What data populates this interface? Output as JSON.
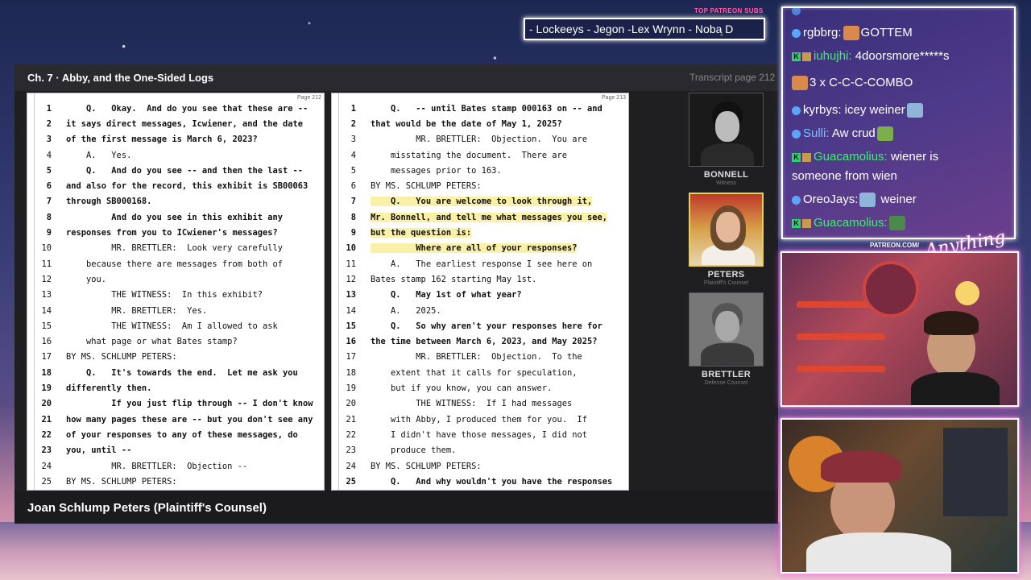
{
  "overlay": {
    "subs_label": "TOP PATREON SUBS",
    "subs_text": "- Lockeeys - Jegon -Lex Wrynn -  Noba D",
    "patreon_label": "PATREON.COM/",
    "logo_script": "Anything Else?"
  },
  "panel": {
    "chapter": "Ch. 7  ·  Abby, and the One-Sided Logs",
    "page_indicator": "Transcript page 212",
    "speaker": "Joan Schlump Peters (Plaintiff's Counsel)"
  },
  "transcript_left": {
    "page_no": "Page 212",
    "lines": [
      {
        "n": "1",
        "t": "    Q.   Okay.  And do you see that these are --",
        "b": true
      },
      {
        "n": "2",
        "t": "it says direct messages, Icwiener, and the date",
        "b": true
      },
      {
        "n": "3",
        "t": "of the first message is March 6, 2023?",
        "b": true
      },
      {
        "n": "4",
        "t": "    A.   Yes.",
        "b": false
      },
      {
        "n": "5",
        "t": "    Q.   And do you see -- and then the last --",
        "b": true
      },
      {
        "n": "6",
        "t": "and also for the record, this exhibit is SB00063",
        "b": true
      },
      {
        "n": "7",
        "t": "through SB000168.",
        "b": true
      },
      {
        "n": "8",
        "t": "         And do you see in this exhibit any",
        "b": true
      },
      {
        "n": "9",
        "t": "responses from you to ICwiener's messages?",
        "b": true
      },
      {
        "n": "10",
        "t": "         MR. BRETTLER:  Look very carefully",
        "b": false
      },
      {
        "n": "11",
        "t": "    because there are messages from both of",
        "b": false
      },
      {
        "n": "12",
        "t": "    you.",
        "b": false
      },
      {
        "n": "13",
        "t": "         THE WITNESS:  In this exhibit?",
        "b": false
      },
      {
        "n": "14",
        "t": "         MR. BRETTLER:  Yes.",
        "b": false
      },
      {
        "n": "15",
        "t": "         THE WITNESS:  Am I allowed to ask",
        "b": false
      },
      {
        "n": "16",
        "t": "    what page or what Bates stamp?",
        "b": false
      },
      {
        "n": "17",
        "t": "BY MS. SCHLUMP PETERS:",
        "b": false
      },
      {
        "n": "18",
        "t": "    Q.   It's towards the end.  Let me ask you",
        "b": true
      },
      {
        "n": "19",
        "t": "differently then.",
        "b": true
      },
      {
        "n": "20",
        "t": "         If you just flip through -- I don't know",
        "b": true
      },
      {
        "n": "21",
        "t": "how many pages these are -- but you don't see any",
        "b": true
      },
      {
        "n": "22",
        "t": "of your responses to any of these messages, do",
        "b": true
      },
      {
        "n": "23",
        "t": "you, until --",
        "b": true
      },
      {
        "n": "24",
        "t": "         MR. BRETTLER:  Objection --",
        "b": false
      },
      {
        "n": "25",
        "t": "BY MS. SCHLUMP PETERS:",
        "b": false
      }
    ]
  },
  "transcript_right": {
    "page_no": "Page 213",
    "lines": [
      {
        "n": "1",
        "t": "    Q.   -- until Bates stamp 000163 on -- and",
        "b": true
      },
      {
        "n": "2",
        "t": "that would be the date of May 1, 2025?",
        "b": true
      },
      {
        "n": "3",
        "t": "         MR. BRETTLER:  Objection.  You are",
        "b": false
      },
      {
        "n": "4",
        "t": "    misstating the document.  There are",
        "b": false
      },
      {
        "n": "5",
        "t": "    messages prior to 163.",
        "b": false
      },
      {
        "n": "6",
        "t": "BY MS. SCHLUMP PETERS:",
        "b": false
      },
      {
        "n": "7",
        "t": "    Q.   You are welcome to look through it,",
        "b": true,
        "h": true
      },
      {
        "n": "8",
        "t": "Mr. Bonnell, and tell me what messages you see,",
        "b": true,
        "h": true
      },
      {
        "n": "9",
        "t": "but the question is:",
        "b": true,
        "h": true
      },
      {
        "n": "10",
        "t": "         Where are all of your responses?",
        "b": true,
        "h": true
      },
      {
        "n": "11",
        "t": "    A.   The earliest response I see here on",
        "b": false
      },
      {
        "n": "12",
        "t": "Bates stamp 162 starting May 1st.",
        "b": false
      },
      {
        "n": "13",
        "t": "    Q.   May 1st of what year?",
        "b": true
      },
      {
        "n": "14",
        "t": "    A.   2025.",
        "b": false
      },
      {
        "n": "15",
        "t": "    Q.   So why aren't your responses here for",
        "b": true
      },
      {
        "n": "16",
        "t": "the time between March 6, 2023, and May 2025?",
        "b": true
      },
      {
        "n": "17",
        "t": "         MR. BRETTLER:  Objection.  To the",
        "b": false
      },
      {
        "n": "18",
        "t": "    extent that it calls for speculation,",
        "b": false
      },
      {
        "n": "19",
        "t": "    but if you know, you can answer.",
        "b": false
      },
      {
        "n": "20",
        "t": "         THE WITNESS:  If I had messages",
        "b": false
      },
      {
        "n": "21",
        "t": "    with Abby, I produced them for you.  If",
        "b": false
      },
      {
        "n": "22",
        "t": "    I didn't have those messages, I did not",
        "b": false
      },
      {
        "n": "23",
        "t": "    produce them.",
        "b": false
      },
      {
        "n": "24",
        "t": "BY MS. SCHLUMP PETERS:",
        "b": false
      },
      {
        "n": "25",
        "t": "    Q.   And why wouldn't you have the responses",
        "b": true
      }
    ]
  },
  "participants": [
    {
      "name": "BONNELL",
      "role": "Witness",
      "active": false
    },
    {
      "name": "PETERS",
      "role": "Plaintiff's Counsel",
      "active": true
    },
    {
      "name": "BRETTLER",
      "role": "Defense Counsel",
      "active": false
    }
  ],
  "chat": {
    "messages": [
      {
        "badges": "blue",
        "user": "rgbbrg:",
        "color": "#ffffff",
        "emote_before": "",
        "emote_after_text": "GOTTEM",
        "emote_color": "#d98a4a"
      },
      {
        "badges": "k",
        "user": "iuhujhi:",
        "color": "#3cf06e",
        "text": " 4doorsmore*****s"
      },
      {
        "badges": "none",
        "user": "",
        "color": "#ffffff",
        "combo": "3 x C-C-C-COMBO"
      },
      {
        "badges": "blue",
        "user": "kyrbys:",
        "color": "#ffffff",
        "text": " icey weiner"
      },
      {
        "badges": "blue",
        "user": "Sulli:",
        "color": "#7fc0ff",
        "text": " Aw crud"
      },
      {
        "badges": "k",
        "user": "Guacamolius:",
        "color": "#3cf06e",
        "text": " wiener is"
      },
      {
        "badges": "none",
        "user": "",
        "color": "#ffffff",
        "text": "someone from wien"
      },
      {
        "badges": "blue",
        "user": "OreoJays:",
        "color": "#ffffff",
        "text": " weiner"
      },
      {
        "badges": "k",
        "user": "Guacamolius:",
        "color": "#3cf06e",
        "text": ""
      }
    ]
  },
  "colors": {
    "highlight": "#fbf0a8",
    "active_border": "#f2cd4a",
    "chat_border": "#ffffff",
    "cam_glow": "#ff4fe0"
  }
}
